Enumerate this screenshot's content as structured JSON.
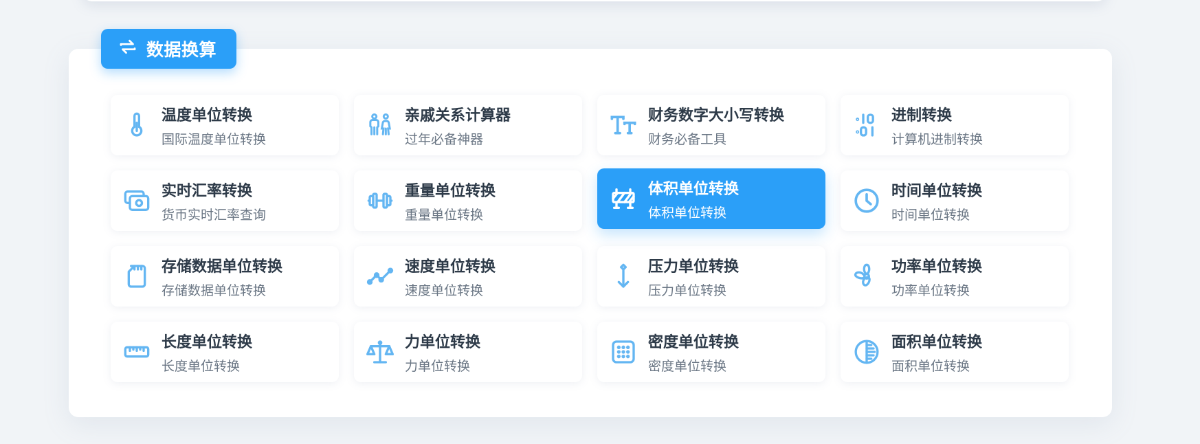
{
  "section": {
    "title": "数据换算",
    "icon": "swap-icon"
  },
  "colors": {
    "accent": "#2b9ff8",
    "icon": "#64b6f2",
    "title": "#2d3a48",
    "subtitle": "#6a7684"
  },
  "items": [
    {
      "title": "温度单位转换",
      "subtitle": "国际温度单位转换",
      "icon": "thermometer-icon",
      "active": false
    },
    {
      "title": "亲戚关系计算器",
      "subtitle": "过年必备神器",
      "icon": "family-icon",
      "active": false
    },
    {
      "title": "财务数字大小写转换",
      "subtitle": "财务必备工具",
      "icon": "text-size-icon",
      "active": false
    },
    {
      "title": "进制转换",
      "subtitle": "计算机进制转换",
      "icon": "binary-icon",
      "active": false
    },
    {
      "title": "实时汇率转换",
      "subtitle": "货币实时汇率查询",
      "icon": "cash-icon",
      "active": false
    },
    {
      "title": "重量单位转换",
      "subtitle": "重量单位转换",
      "icon": "dumbbell-icon",
      "active": false
    },
    {
      "title": "体积单位转换",
      "subtitle": "体积单位转换",
      "icon": "barrier-icon",
      "active": true
    },
    {
      "title": "时间单位转换",
      "subtitle": "时间单位转换",
      "icon": "clock-icon",
      "active": false
    },
    {
      "title": "存储数据单位转换",
      "subtitle": "存储数据单位转换",
      "icon": "sd-card-icon",
      "active": false
    },
    {
      "title": "速度单位转换",
      "subtitle": "速度单位转换",
      "icon": "line-chart-icon",
      "active": false
    },
    {
      "title": "压力单位转换",
      "subtitle": "压力单位转换",
      "icon": "pressure-arrow-icon",
      "active": false
    },
    {
      "title": "功率单位转换",
      "subtitle": "功率单位转换",
      "icon": "fan-icon",
      "active": false
    },
    {
      "title": "长度单位转换",
      "subtitle": "长度单位转换",
      "icon": "ruler-icon",
      "active": false
    },
    {
      "title": "力单位转换",
      "subtitle": "力单位转换",
      "icon": "scale-icon",
      "active": false
    },
    {
      "title": "密度单位转换",
      "subtitle": "密度单位转换",
      "icon": "dots-grid-icon",
      "active": false
    },
    {
      "title": "面积单位转换",
      "subtitle": "面积单位转换",
      "icon": "half-circle-icon",
      "active": false
    }
  ]
}
